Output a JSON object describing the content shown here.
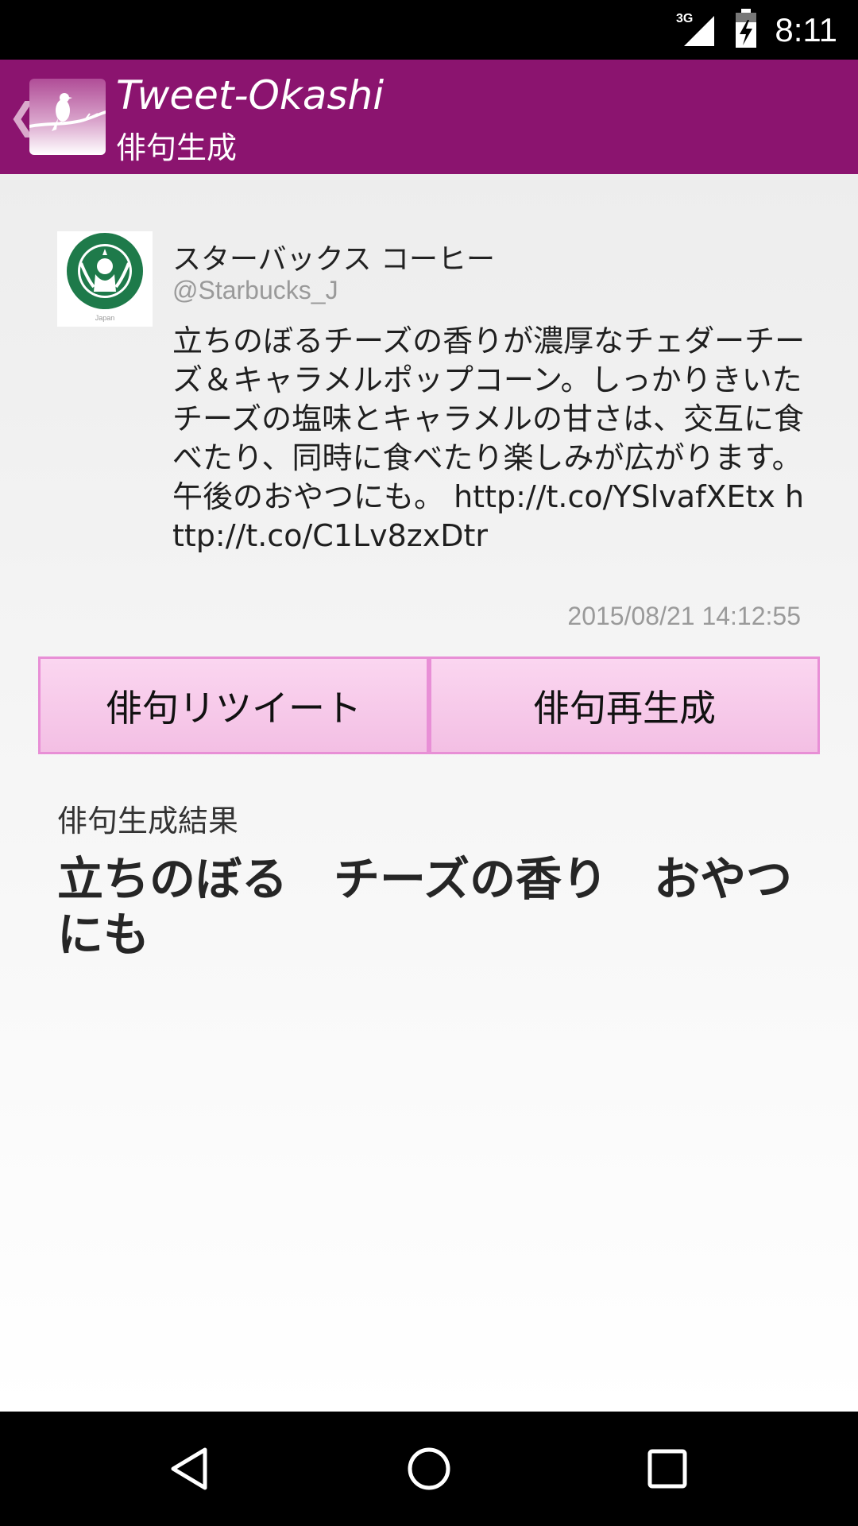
{
  "status_bar": {
    "network": "3G",
    "time": "8:11"
  },
  "action_bar": {
    "title": "Tweet-Okashi",
    "subtitle": "俳句生成",
    "back_icon": "chevron-left-icon",
    "color": "#8b146f"
  },
  "tweet": {
    "name": "スターバックス コーヒー",
    "handle": "@Starbucks_J",
    "avatar_text": "Japan",
    "text": "立ちのぼるチーズの香りが濃厚なチェダーチーズ＆キャラメルポップコーン。しっかりきいたチーズの塩味とキャラメルの甘さは、交互に食べたり、同時に食べたり楽しみが広がります。午後のおやつにも。 http://t.co/YSlvafXEtx http://t.co/C1Lv8zxDtr",
    "date": "2015/08/21 14:12:55"
  },
  "buttons": {
    "retweet_label": "俳句リツイート",
    "regenerate_label": "俳句再生成"
  },
  "result": {
    "label": "俳句生成結果",
    "haiku": "立ちのぼる　チーズの香り　おやつにも"
  },
  "nav": {
    "back": "back-triangle-icon",
    "home": "home-circle-icon",
    "recents": "recents-square-icon"
  }
}
